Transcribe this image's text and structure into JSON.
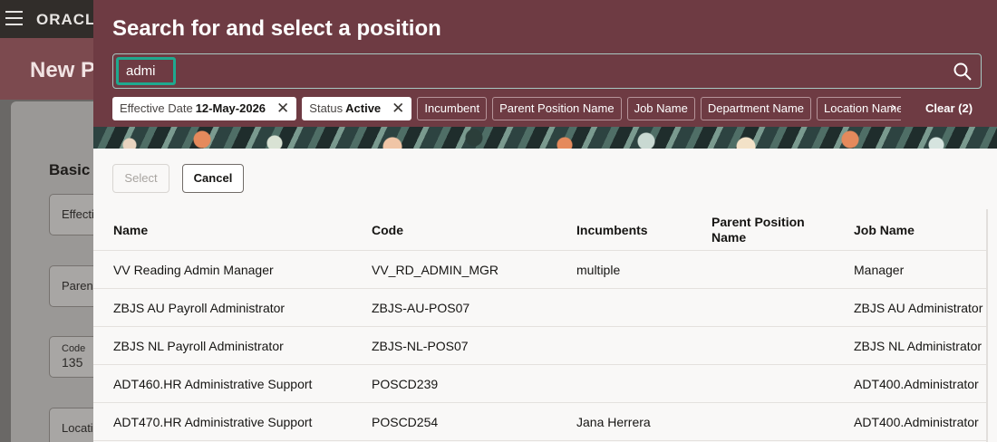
{
  "background": {
    "logo": "ORACLE",
    "page_title": "New P",
    "section_title": "Basic",
    "fields": [
      {
        "label": "Effecti"
      },
      {
        "label": "Parent"
      },
      {
        "label": "Code",
        "value": "135"
      },
      {
        "label": "Locati"
      }
    ]
  },
  "dialog": {
    "title": "Search for and select a position",
    "search": {
      "value": "admi"
    },
    "filters": [
      {
        "label": "Effective Date",
        "value": "12-May-2026",
        "removable": true
      },
      {
        "label": "Status",
        "value": "Active",
        "removable": true
      },
      {
        "label": "Incumbent"
      },
      {
        "label": "Parent Position Name"
      },
      {
        "label": "Job Name"
      },
      {
        "label": "Department Name"
      },
      {
        "label": "Location Name"
      }
    ],
    "clear_label": "Clear (2)",
    "select_label": "Select",
    "cancel_label": "Cancel",
    "table": {
      "columns": [
        "Name",
        "Code",
        "Incumbents",
        "Parent Position Name",
        "Job Name"
      ],
      "rows": [
        [
          "VV Reading Admin Manager",
          "VV_RD_ADMIN_MGR",
          "multiple",
          "",
          "Manager"
        ],
        [
          "ZBJS AU Payroll Administrator",
          "ZBJS-AU-POS07",
          "",
          "",
          "ZBJS AU Administrator"
        ],
        [
          "ZBJS NL Payroll Administrator",
          "ZBJS-NL-POS07",
          "",
          "",
          "ZBJS NL Administrator"
        ],
        [
          "ADT460.HR Administrative Support",
          "POSCD239",
          "",
          "",
          "ADT400.Administrator"
        ],
        [
          "ADT470.HR Administrative Support",
          "POSCD254",
          "Jana Herrera",
          "",
          "ADT400.Administrator"
        ]
      ]
    }
  },
  "colors": {
    "header": "#6e3b43",
    "focus_ring": "#1fa98f"
  }
}
